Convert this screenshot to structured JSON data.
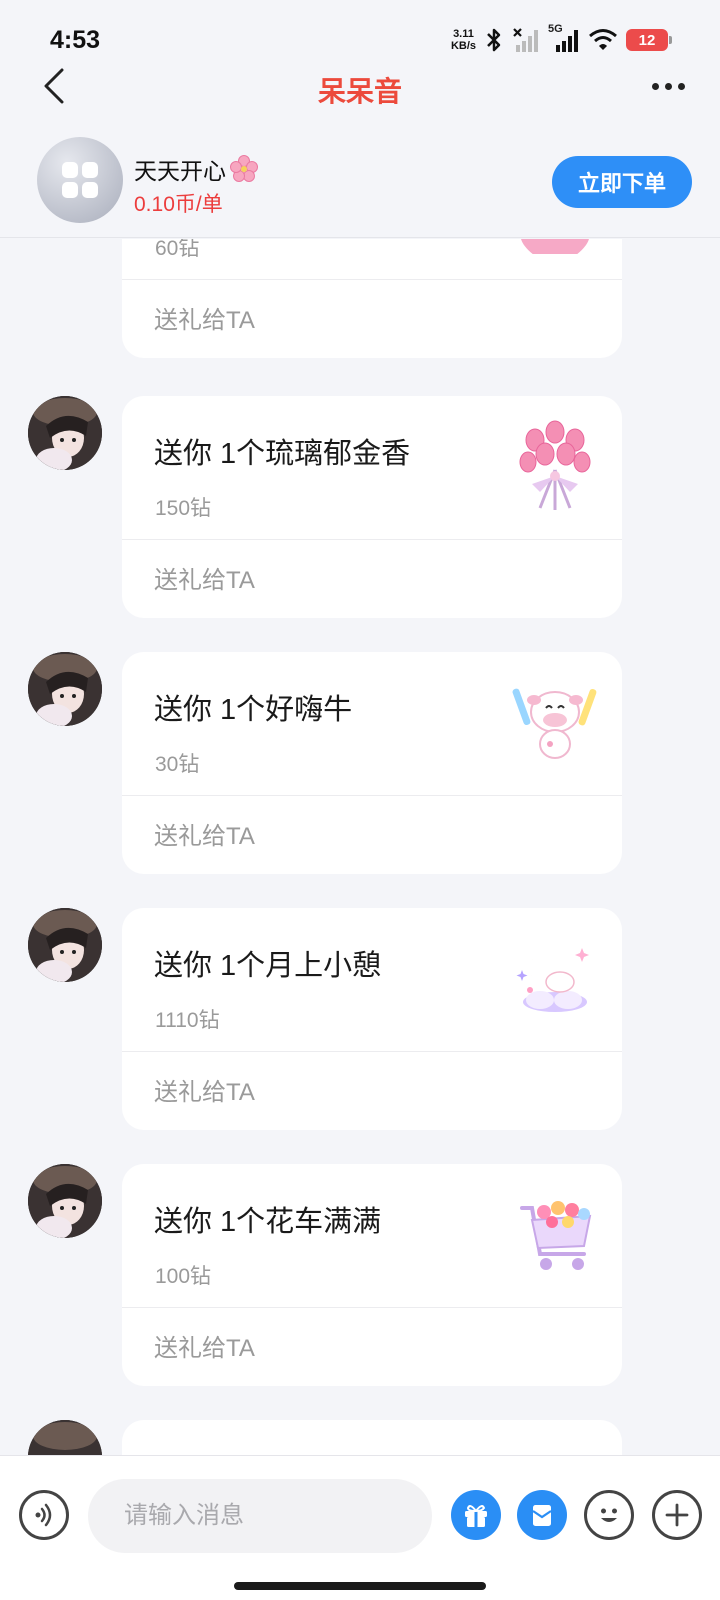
{
  "status_bar": {
    "time": "4:53",
    "net_speed_value": "3.11",
    "net_speed_unit": "KB/s",
    "network": "5G",
    "battery": "12"
  },
  "header": {
    "title": "呆呆音"
  },
  "service": {
    "name": "天天开心",
    "price": "0.10币/单",
    "order_button": "立即下单"
  },
  "messages": [
    {
      "title": "",
      "price": "60钻",
      "action": "送礼给TA",
      "gift_icon": "heart-gift-icon"
    },
    {
      "title": "送你 1个琉璃郁金香",
      "price": "150钻",
      "action": "送礼给TA",
      "gift_icon": "tulip-bouquet-icon"
    },
    {
      "title": "送你 1个好嗨牛",
      "price": "30钻",
      "action": "送礼给TA",
      "gift_icon": "happy-cow-icon"
    },
    {
      "title": "送你 1个月上小憩",
      "price": "1110钻",
      "action": "送礼给TA",
      "gift_icon": "moon-nap-icon"
    },
    {
      "title": "送你 1个花车满满",
      "price": "100钻",
      "action": "送礼给TA",
      "gift_icon": "flower-cart-icon"
    }
  ],
  "input_bar": {
    "placeholder": "请输入消息"
  },
  "colors": {
    "brand_red": "#ec4a3c",
    "accent_blue": "#2e8ff7",
    "background": "#f4f5f9"
  }
}
